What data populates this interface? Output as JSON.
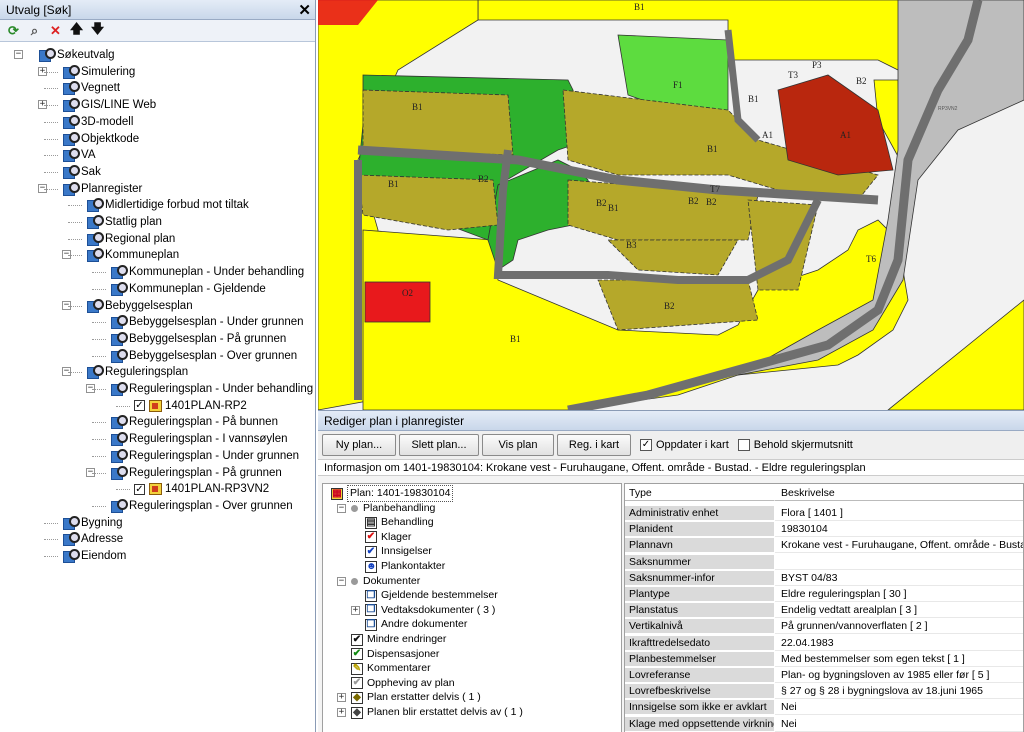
{
  "left_panel": {
    "title": "Utvalg [Søk]",
    "close_glyph": "✕",
    "toolbar": [
      {
        "icon": "refresh-icon",
        "glyph": "⟳",
        "color": "#2a8a2a"
      },
      {
        "icon": "find-icon",
        "glyph": "⌕",
        "color": "#555"
      },
      {
        "icon": "delete-icon",
        "glyph": "✕",
        "color": "#d22"
      },
      {
        "icon": "move-up-icon",
        "glyph": "🡅",
        "color": "#111"
      },
      {
        "icon": "move-down-icon",
        "glyph": "🡇",
        "color": "#111"
      }
    ],
    "tree": [
      {
        "label": "Søkeutvalg",
        "level": 0,
        "expander": "−",
        "icon": "search"
      },
      {
        "label": "Simulering",
        "level": 1,
        "expander": "+",
        "icon": "search"
      },
      {
        "label": "Vegnett",
        "level": 1,
        "expander": "",
        "icon": "search"
      },
      {
        "label": "GIS/LINE Web",
        "level": 1,
        "expander": "+",
        "icon": "search"
      },
      {
        "label": "3D-modell",
        "level": 1,
        "expander": "",
        "icon": "search"
      },
      {
        "label": "Objektkode",
        "level": 1,
        "expander": "",
        "icon": "search"
      },
      {
        "label": "VA",
        "level": 1,
        "expander": "",
        "icon": "search"
      },
      {
        "label": "Sak",
        "level": 1,
        "expander": "",
        "icon": "search"
      },
      {
        "label": "Planregister",
        "level": 1,
        "expander": "−",
        "icon": "search"
      },
      {
        "label": "Midlertidige forbud mot tiltak",
        "level": 2,
        "expander": "",
        "icon": "search"
      },
      {
        "label": "Statlig plan",
        "level": 2,
        "expander": "",
        "icon": "search"
      },
      {
        "label": "Regional plan",
        "level": 2,
        "expander": "",
        "icon": "search"
      },
      {
        "label": "Kommuneplan",
        "level": 2,
        "expander": "−",
        "icon": "search"
      },
      {
        "label": "Kommuneplan - Under behandling",
        "level": 3,
        "expander": "",
        "icon": "search"
      },
      {
        "label": "Kommuneplan - Gjeldende",
        "level": 3,
        "expander": "",
        "icon": "search"
      },
      {
        "label": "Bebyggelsesplan",
        "level": 2,
        "expander": "−",
        "icon": "search"
      },
      {
        "label": "Bebyggelsesplan - Under grunnen",
        "level": 3,
        "expander": "",
        "icon": "search"
      },
      {
        "label": "Bebyggelsesplan - På grunnen",
        "level": 3,
        "expander": "",
        "icon": "search"
      },
      {
        "label": "Bebyggelsesplan - Over grunnen",
        "level": 3,
        "expander": "",
        "icon": "search"
      },
      {
        "label": "Reguleringsplan",
        "level": 2,
        "expander": "−",
        "icon": "search"
      },
      {
        "label": "Reguleringsplan - Under behandling",
        "level": 3,
        "expander": "−",
        "icon": "search"
      },
      {
        "label": "1401PLAN-RP2",
        "level": 4,
        "expander": "",
        "icon": "plan",
        "checked": true
      },
      {
        "label": "Reguleringsplan - På bunnen",
        "level": 3,
        "expander": "",
        "icon": "search"
      },
      {
        "label": "Reguleringsplan - I vannsøylen",
        "level": 3,
        "expander": "",
        "icon": "search"
      },
      {
        "label": "Reguleringsplan - Under grunnen",
        "level": 3,
        "expander": "",
        "icon": "search"
      },
      {
        "label": "Reguleringsplan - På grunnen",
        "level": 3,
        "expander": "−",
        "icon": "search"
      },
      {
        "label": "1401PLAN-RP3VN2",
        "level": 4,
        "expander": "",
        "icon": "plan",
        "checked": true
      },
      {
        "label": "Reguleringsplan - Over grunnen",
        "level": 3,
        "expander": "",
        "icon": "search"
      },
      {
        "label": "Bygning",
        "level": 1,
        "expander": "",
        "icon": "search"
      },
      {
        "label": "Adresse",
        "level": 1,
        "expander": "",
        "icon": "search"
      },
      {
        "label": "Eiendom",
        "level": 1,
        "expander": "",
        "icon": "search"
      }
    ]
  },
  "map": {
    "colors": {
      "yellow": "#ffff00",
      "olive": "#b5a82a",
      "green": "#2db02d",
      "light_green": "#5ddc3f",
      "red": "#b9270e",
      "bright_red": "#e8191c",
      "road": "#6f6f6f",
      "grey": "#bdbdbd"
    },
    "labels": [
      "B1",
      "F1",
      "B1",
      "T3",
      "B2",
      "A1",
      "A1",
      "B1",
      "B1",
      "B2",
      "B1",
      "B1",
      "B2",
      "B2",
      "B2",
      "B3",
      "T7",
      "T6",
      "O2",
      "B2",
      "B1",
      "P3"
    ],
    "small_text": "RP3VN2"
  },
  "edit_panel": {
    "title": "Rediger plan i planregister",
    "buttons": [
      {
        "name": "new-plan-button",
        "label": "Ny plan..."
      },
      {
        "name": "delete-plan-button",
        "label": "Slett plan..."
      },
      {
        "name": "show-plan-button",
        "label": "Vis plan"
      },
      {
        "name": "register-in-map-button",
        "label": "Reg. i kart"
      }
    ],
    "checkboxes": [
      {
        "name": "update-in-map-checkbox",
        "label": "Oppdater i kart",
        "checked": true
      },
      {
        "name": "keep-screen-extent-checkbox",
        "label": "Behold skjermutsnitt",
        "checked": false
      }
    ],
    "info": "Informasjon om 1401-19830104: Krokane vest - Furuhaugane, Offent. område - Bustad. - Eldre reguleringsplan",
    "plan_tree": [
      {
        "label": "Plan: 1401-19830104",
        "level": 0,
        "expander": "",
        "icon": "plan-icon",
        "glyph": "▦",
        "selected": true
      },
      {
        "label": "Planbehandling",
        "level": 1,
        "expander": "−",
        "icon": "dot"
      },
      {
        "label": "Behandling",
        "level": 2,
        "expander": "",
        "icon": "calendar-icon",
        "glyph": "▤"
      },
      {
        "label": "Klager",
        "level": 2,
        "expander": "",
        "icon": "red-check-icon",
        "glyph": "✔",
        "color": "#d11"
      },
      {
        "label": "Innsigelser",
        "level": 2,
        "expander": "",
        "icon": "blue-check-icon",
        "glyph": "✔",
        "color": "#1240c0"
      },
      {
        "label": "Plankontakter",
        "level": 2,
        "expander": "",
        "icon": "person-icon",
        "glyph": "☻",
        "color": "#1240c0"
      },
      {
        "label": "Dokumenter",
        "level": 1,
        "expander": "−",
        "icon": "dot"
      },
      {
        "label": "Gjeldende bestemmelser",
        "level": 2,
        "expander": "",
        "icon": "document-icon",
        "glyph": "❐",
        "color": "#1d4f96"
      },
      {
        "label": "Vedtaksdokumenter ( 3 )",
        "level": 2,
        "expander": "+",
        "icon": "document-icon",
        "glyph": "❐",
        "color": "#1d4f96"
      },
      {
        "label": "Andre dokumenter",
        "level": 2,
        "expander": "",
        "icon": "document-icon",
        "glyph": "❐",
        "color": "#1d4f96"
      },
      {
        "label": "Mindre endringer",
        "level": 1,
        "expander": "",
        "icon": "black-check-icon",
        "glyph": "✔",
        "color": "#111"
      },
      {
        "label": "Dispensasjoner",
        "level": 1,
        "expander": "",
        "icon": "green-check-icon",
        "glyph": "✔",
        "color": "#118a11"
      },
      {
        "label": "Kommentarer",
        "level": 1,
        "expander": "",
        "icon": "yellow-note-icon",
        "glyph": "✎",
        "color": "#b8a100"
      },
      {
        "label": "Oppheving av plan",
        "level": 1,
        "expander": "",
        "icon": "grey-check-icon",
        "glyph": "✔",
        "color": "#999"
      },
      {
        "label": "Plan erstatter delvis ( 1 )",
        "level": 1,
        "expander": "+",
        "icon": "replace-icon",
        "glyph": "◆",
        "color": "#7a6a00"
      },
      {
        "label": "Planen blir erstattet delvis av ( 1 )",
        "level": 1,
        "expander": "+",
        "icon": "replaced-icon",
        "glyph": "◆",
        "color": "#444"
      }
    ],
    "properties": {
      "header": {
        "key": "Type",
        "value": "Beskrivelse"
      },
      "rows": [
        {
          "key": "Administrativ enhet",
          "value": "Flora  [ 1401 ]"
        },
        {
          "key": "Planident",
          "value": "19830104"
        },
        {
          "key": "Plannavn",
          "value": "Krokane vest - Furuhaugane, Offent. område - Bustad."
        },
        {
          "key": "Saksnummer",
          "value": ""
        },
        {
          "key": "Saksnummer-infor",
          "value": "BYST 04/83"
        },
        {
          "key": "Plantype",
          "value": "Eldre reguleringsplan [ 30 ]"
        },
        {
          "key": "Planstatus",
          "value": "Endelig vedtatt arealplan [ 3 ]"
        },
        {
          "key": "Vertikalnivå",
          "value": "På grunnen/vannoverflaten [ 2 ]"
        },
        {
          "key": "Ikrafttredelsedato",
          "value": "22.04.1983"
        },
        {
          "key": "Planbestemmelser",
          "value": "Med bestemmelser som egen tekst [ 1 ]"
        },
        {
          "key": "Lovreferanse",
          "value": "Plan- og bygningsloven av  1985 eller før [ 5 ]"
        },
        {
          "key": "Lovrefbeskrivelse",
          "value": "§ 27 og § 28 i bygningslova av 18.juni 1965"
        },
        {
          "key": "Innsigelse som ikke er avklart",
          "value": "Nei"
        },
        {
          "key": "Klage med oppsettende virkning",
          "value": "Nei"
        }
      ]
    }
  }
}
